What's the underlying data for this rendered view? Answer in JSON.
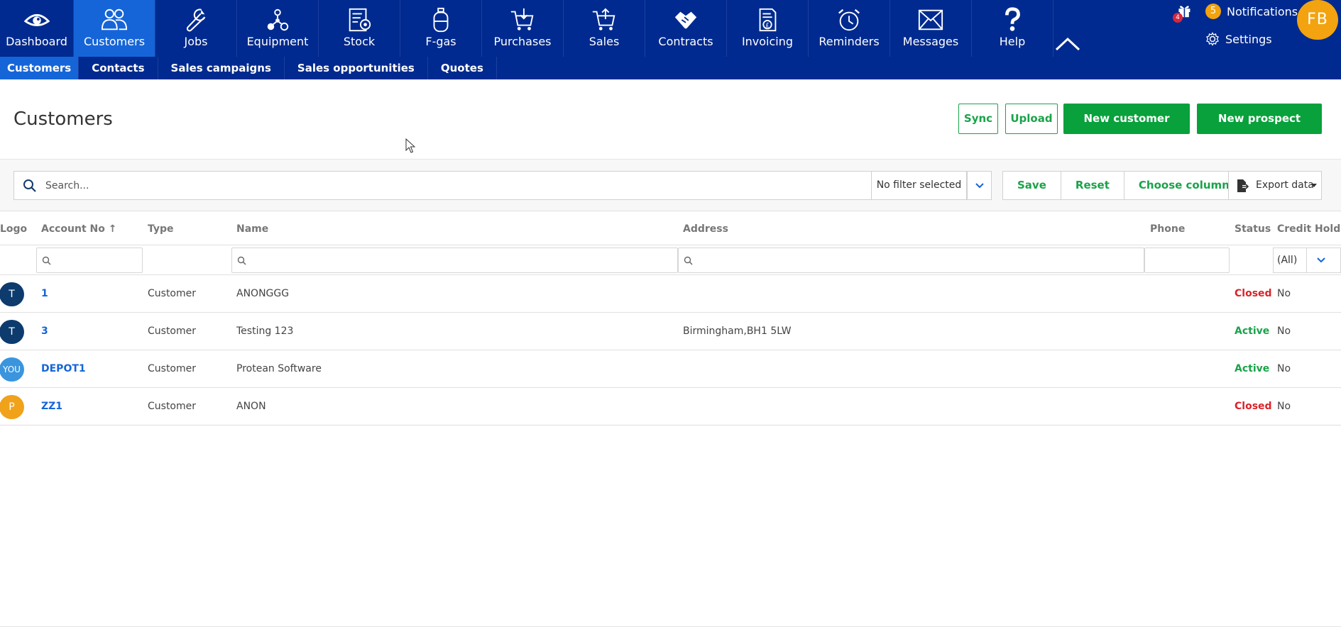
{
  "nav": {
    "items": [
      {
        "label": "Dashboard",
        "icon": "eye-icon",
        "active": false
      },
      {
        "label": "Customers",
        "icon": "people-icon",
        "active": true
      },
      {
        "label": "Jobs",
        "icon": "wrench-icon",
        "active": false
      },
      {
        "label": "Equipment",
        "icon": "molecule-icon",
        "active": false
      },
      {
        "label": "Stock",
        "icon": "stock-icon",
        "active": false
      },
      {
        "label": "F-gas",
        "icon": "gas-cylinder-icon",
        "active": false
      },
      {
        "label": "Purchases",
        "icon": "cart-down-icon",
        "active": false
      },
      {
        "label": "Sales",
        "icon": "cart-up-icon",
        "active": false
      },
      {
        "label": "Contracts",
        "icon": "handshake-icon",
        "active": false
      },
      {
        "label": "Invoicing",
        "icon": "invoice-icon",
        "active": false
      },
      {
        "label": "Reminders",
        "icon": "alarm-clock-icon",
        "active": false
      },
      {
        "label": "Messages",
        "icon": "envelope-icon",
        "active": false
      },
      {
        "label": "Help",
        "icon": "question-icon",
        "active": false
      }
    ],
    "gift_badge": "4",
    "notifications_count": "5",
    "notifications_label": "Notifications",
    "settings_label": "Settings",
    "user_initials": "FB"
  },
  "subnav": {
    "items": [
      {
        "label": "Customers",
        "active": true
      },
      {
        "label": "Contacts",
        "active": false
      },
      {
        "label": "Sales campaigns",
        "active": false
      },
      {
        "label": "Sales opportunities",
        "active": false
      },
      {
        "label": "Quotes",
        "active": false
      }
    ]
  },
  "page": {
    "title": "Customers",
    "buttons": {
      "sync": "Sync",
      "upload": "Upload",
      "new_customer": "New customer",
      "new_prospect": "New prospect"
    }
  },
  "toolbar": {
    "search_placeholder": "Search...",
    "filter_value": "No filter selected",
    "save": "Save",
    "reset": "Reset",
    "choose_columns": "Choose columns",
    "export": "Export data"
  },
  "grid": {
    "columns": {
      "logo": "Logo",
      "account_no": "Account No",
      "sort_indicator": "↑",
      "type": "Type",
      "name": "Name",
      "address": "Address",
      "phone": "Phone",
      "status": "Status",
      "credit_hold": "Credit Hold"
    },
    "credit_hold_filter": "(All)",
    "rows": [
      {
        "logo": "T",
        "logo_color": "#0d3b6e",
        "account_no": "1",
        "type": "Customer",
        "name": "ANONGGG",
        "address": "",
        "phone": "",
        "status": "Closed",
        "status_color": "#d8232a",
        "credit_hold": "No"
      },
      {
        "logo": "T",
        "logo_color": "#0d3b6e",
        "account_no": "3",
        "type": "Customer",
        "name": "Testing 123",
        "address": "Birmingham,BH1 5LW",
        "phone": "",
        "status": "Active",
        "status_color": "#1aa34a",
        "credit_hold": "No"
      },
      {
        "logo": "YOU",
        "logo_color": "#3a95de",
        "account_no": "DEPOT1",
        "type": "Customer",
        "name": "Protean Software",
        "address": "",
        "phone": "",
        "status": "Active",
        "status_color": "#1aa34a",
        "credit_hold": "No"
      },
      {
        "logo": "P",
        "logo_color": "#f0a21a",
        "account_no": "ZZ1",
        "type": "Customer",
        "name": "ANON",
        "address": "",
        "phone": "",
        "status": "Closed",
        "status_color": "#d8232a",
        "credit_hold": "No"
      }
    ]
  }
}
